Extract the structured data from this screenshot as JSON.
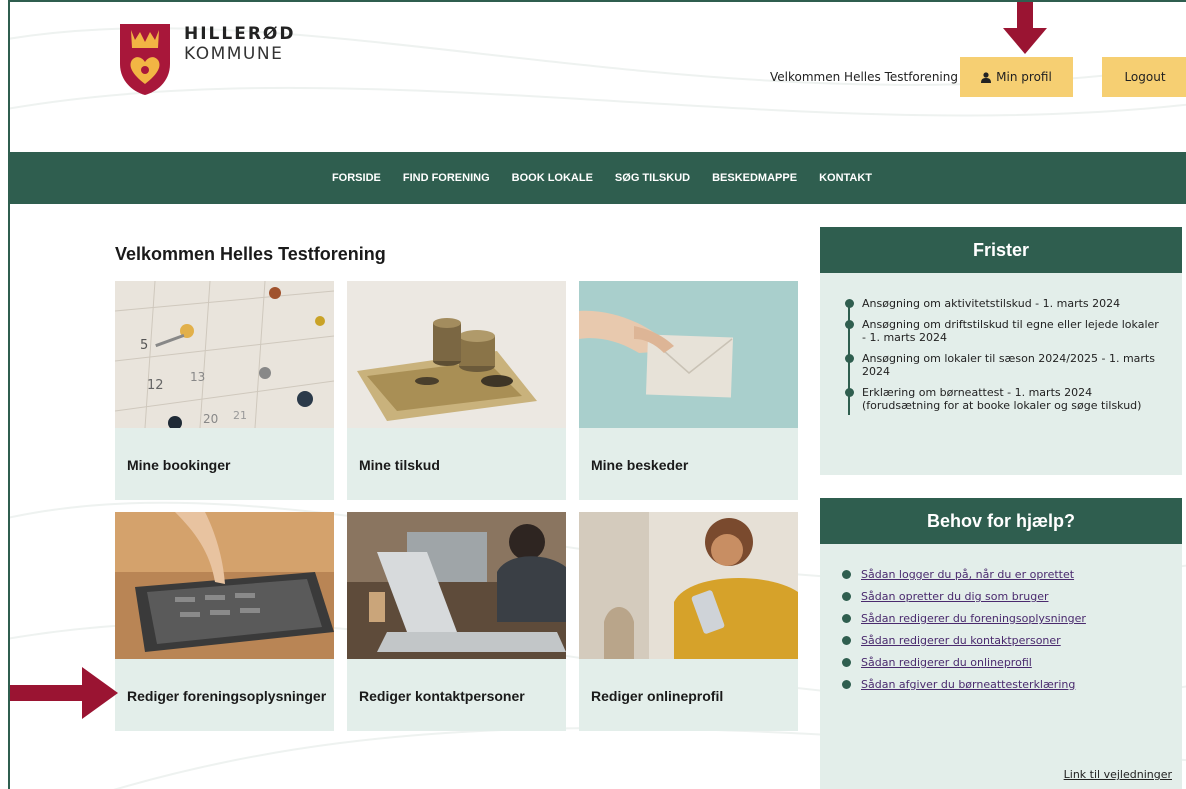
{
  "header": {
    "logo_line1": "HILLERØD",
    "logo_line2": "KOMMUNE",
    "welcome_text": "Velkommen Helles Testforening",
    "profile_button_label": "Min profil",
    "logout_button_label": "Logout"
  },
  "nav": {
    "items": [
      "FORSIDE",
      "FIND FORENING",
      "BOOK LOKALE",
      "SØG TILSKUD",
      "BESKEDMAPPE",
      "KONTAKT"
    ]
  },
  "main": {
    "title": "Velkommen Helles Testforening",
    "tiles": [
      {
        "label": "Mine bookinger",
        "icon": "calendar-pins-image"
      },
      {
        "label": "Mine tilskud",
        "icon": "coins-image"
      },
      {
        "label": "Mine beskeder",
        "icon": "envelope-image"
      },
      {
        "label": "Rediger foreningsoplysninger",
        "icon": "tablet-image"
      },
      {
        "label": "Rediger kontaktpersoner",
        "icon": "laptop-image"
      },
      {
        "label": "Rediger onlineprofil",
        "icon": "phone-person-image"
      }
    ]
  },
  "sidebar": {
    "frister": {
      "title": "Frister",
      "items": [
        "Ansøgning om aktivitetstilskud - 1. marts 2024",
        "Ansøgning om driftstilskud til egne eller lejede lokaler - 1. marts 2024",
        "Ansøgning om lokaler til sæson 2024/2025 - 1. marts 2024",
        "Erklæring om børneattest - 1. marts 2024 (forudsætning for at booke lokaler og søge tilskud)"
      ]
    },
    "help": {
      "title": "Behov for hjælp?",
      "links": [
        "Sådan logger du på, når du er oprettet",
        "Sådan opretter du dig som bruger",
        "Sådan redigerer du foreningsoplysninger",
        "Sådan redigerer du kontaktpersoner",
        "Sådan redigerer du onlineprofil",
        "Sådan afgiver du børneattesterklæring"
      ],
      "footer_link": "Link til vejledninger"
    }
  },
  "colors": {
    "brand_green": "#2f5e4f",
    "tile_bg": "#e3eeea",
    "button_yellow": "#f6cf72",
    "arrow_red": "#9a1432"
  }
}
